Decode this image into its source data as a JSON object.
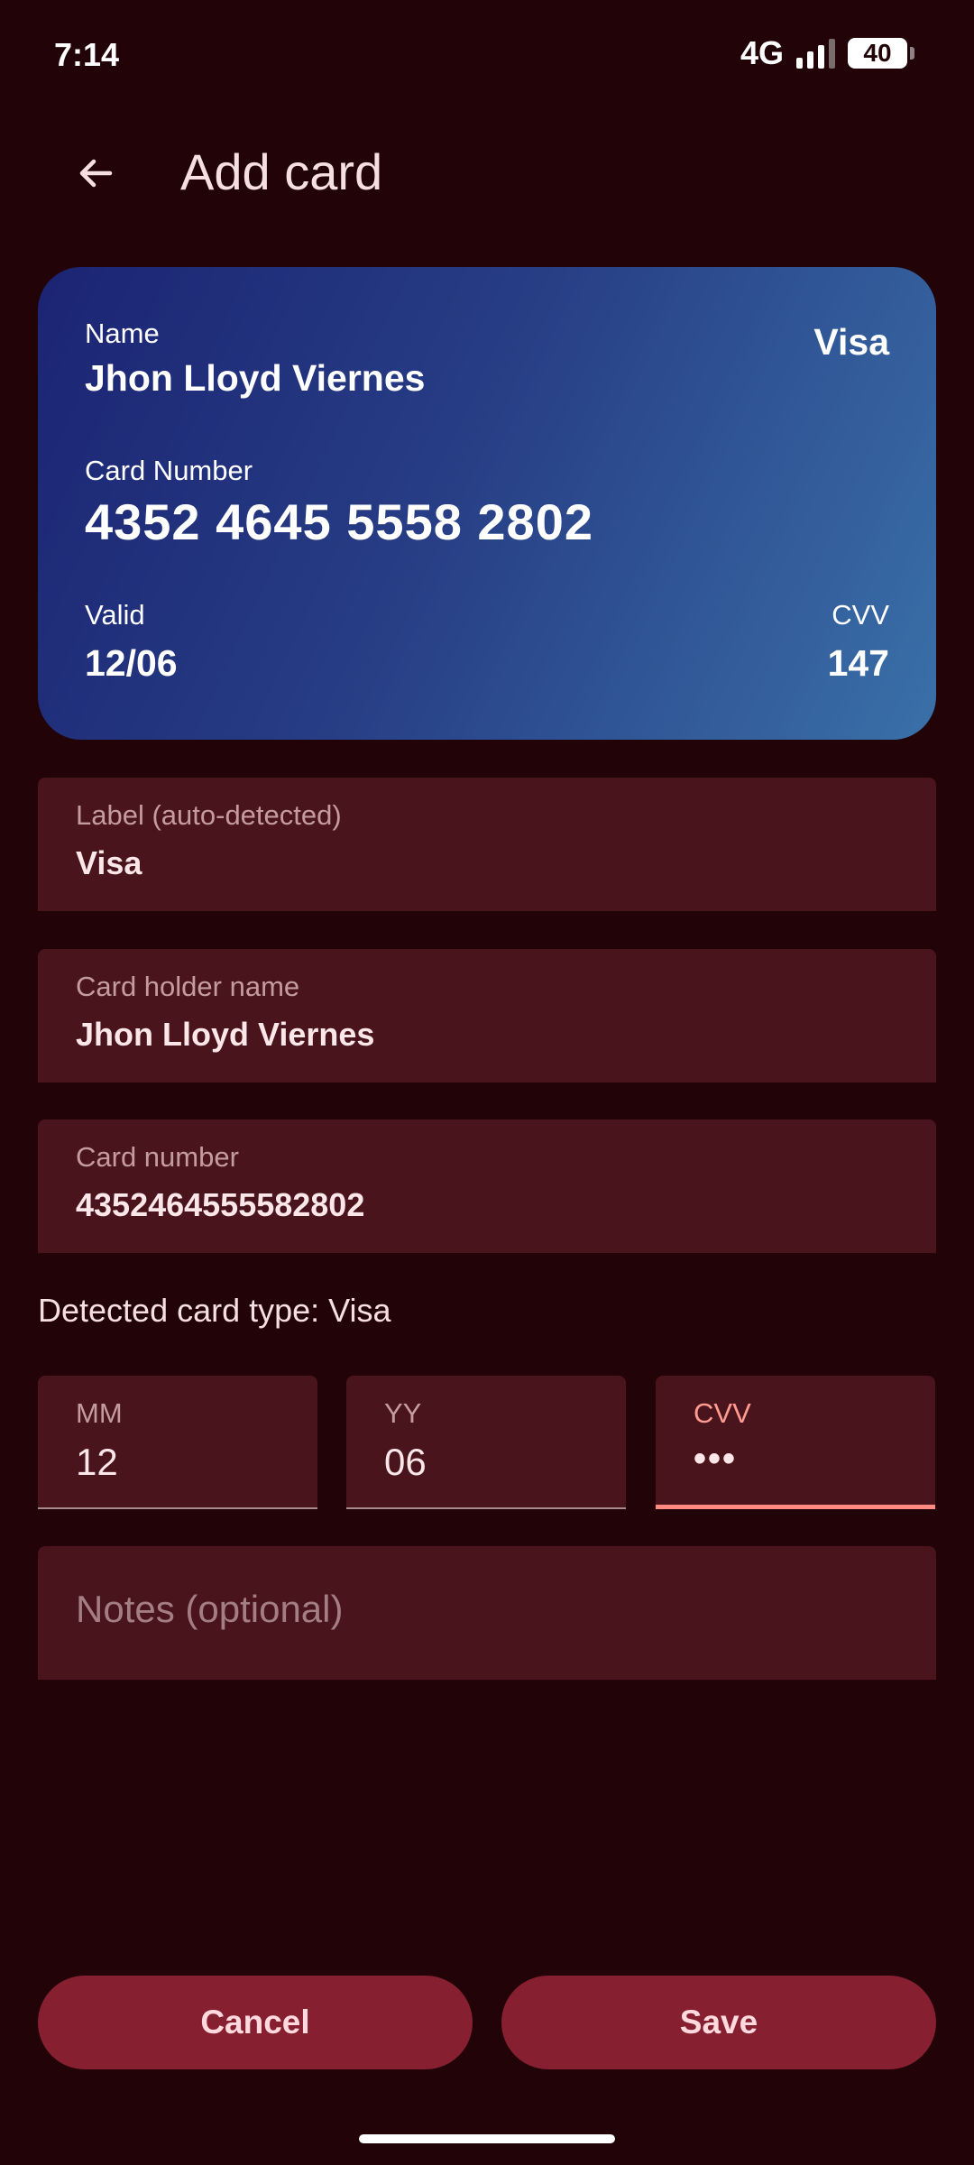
{
  "status_bar": {
    "time": "7:14",
    "network": "4G",
    "battery": "40"
  },
  "app_bar": {
    "back_icon": "arrow-left-icon",
    "title": "Add card"
  },
  "card_preview": {
    "name_label": "Name",
    "name_value": "Jhon Lloyd Viernes",
    "brand": "Visa",
    "number_label": "Card Number",
    "number_value": "4352 4645 5558 2802",
    "valid_label": "Valid",
    "valid_value": "12/06",
    "cvv_label": "CVV",
    "cvv_value": "147"
  },
  "form": {
    "label_field": {
      "label": "Label (auto-detected)",
      "value": "Visa"
    },
    "holder_field": {
      "label": "Card holder name",
      "value": "Jhon Lloyd Viernes"
    },
    "number_field": {
      "label": "Card number",
      "value": "4352464555582802"
    },
    "detected_type": "Detected card type: Visa",
    "mm_field": {
      "label": "MM",
      "value": "12"
    },
    "yy_field": {
      "label": "YY",
      "value": "06"
    },
    "cvv_field": {
      "label": "CVV",
      "value": "•••"
    },
    "notes_field": {
      "placeholder": "Notes (optional)"
    }
  },
  "actions": {
    "cancel": "Cancel",
    "save": "Save"
  },
  "colors": {
    "background": "#210308",
    "field_bg": "#4a141c",
    "button_bg": "#861f30",
    "focus_accent": "#ff8a82",
    "card_gradient_start": "#1b2473",
    "card_gradient_end": "#3a70a8"
  }
}
